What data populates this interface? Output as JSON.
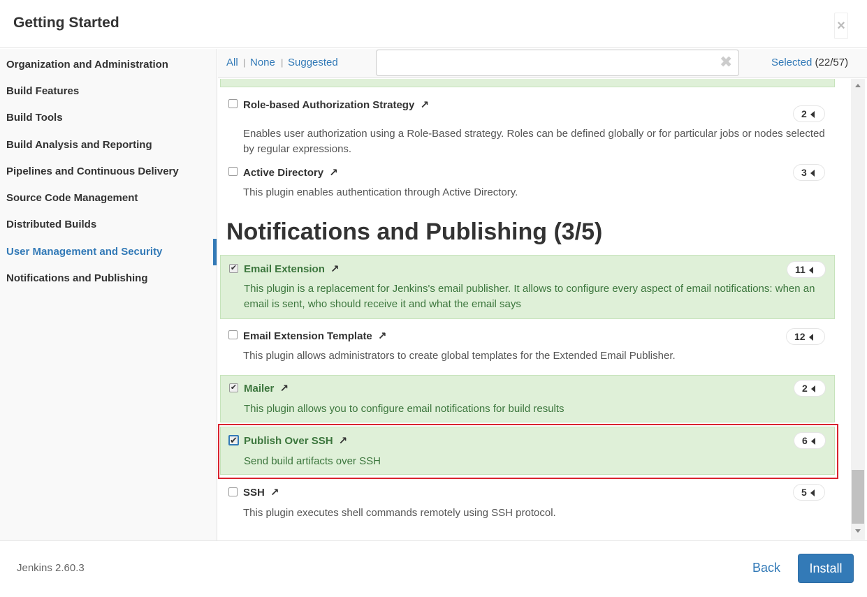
{
  "header": {
    "title": "Getting Started",
    "close_label": "×"
  },
  "sidebar": {
    "items": [
      {
        "label": "Organization and Administration",
        "active": false
      },
      {
        "label": "Build Features",
        "active": false
      },
      {
        "label": "Build Tools",
        "active": false
      },
      {
        "label": "Build Analysis and Reporting",
        "active": false
      },
      {
        "label": "Pipelines and Continuous Delivery",
        "active": false
      },
      {
        "label": "Source Code Management",
        "active": false
      },
      {
        "label": "Distributed Builds",
        "active": false
      },
      {
        "label": "User Management and Security",
        "active": true
      },
      {
        "label": "Notifications and Publishing",
        "active": false
      }
    ]
  },
  "toolbar": {
    "all_label": "All",
    "none_label": "None",
    "suggested_label": "Suggested",
    "separator": "|",
    "search_value": "",
    "search_clear": "✖",
    "selected_label": "Selected",
    "selected_count": "(22/57)"
  },
  "plugins_security": [
    {
      "name": "Role-based Authorization Strategy",
      "checked": false,
      "deps": "2",
      "desc": "Enables user authorization using a Role-Based strategy. Roles can be defined globally or for particular jobs or nodes selected by regular expressions."
    },
    {
      "name": "Active Directory",
      "checked": false,
      "deps": "3",
      "desc": "This plugin enables authentication through Active Directory."
    }
  ],
  "section": {
    "title": "Notifications and Publishing (3/5)"
  },
  "plugins_notifications": [
    {
      "name": "Email Extension",
      "checked": true,
      "deps": "11",
      "desc": "This plugin is a replacement for Jenkins's email publisher. It allows to configure every aspect of email notifications: when an email is sent, who should receive it and what the email says"
    },
    {
      "name": "Email Extension Template",
      "checked": false,
      "deps": "12",
      "desc": "This plugin allows administrators to create global templates for the Extended Email Publisher."
    },
    {
      "name": "Mailer",
      "checked": true,
      "deps": "2",
      "desc": "This plugin allows you to configure email notifications for build results"
    },
    {
      "name": "Publish Over SSH",
      "checked": true,
      "deps": "6",
      "desc": "Send build artifacts over SSH"
    },
    {
      "name": "SSH",
      "checked": false,
      "deps": "5",
      "desc": "This plugin executes shell commands remotely using SSH protocol."
    }
  ],
  "icons": {
    "external_link": "↗",
    "checkmark": "✔"
  },
  "footer": {
    "version": "Jenkins 2.60.3",
    "back_label": "Back",
    "install_label": "Install"
  },
  "colors": {
    "accent": "#337ab7",
    "selected_bg": "#dff0d8",
    "selected_text": "#3c763d",
    "highlight_border": "#d9232e"
  }
}
